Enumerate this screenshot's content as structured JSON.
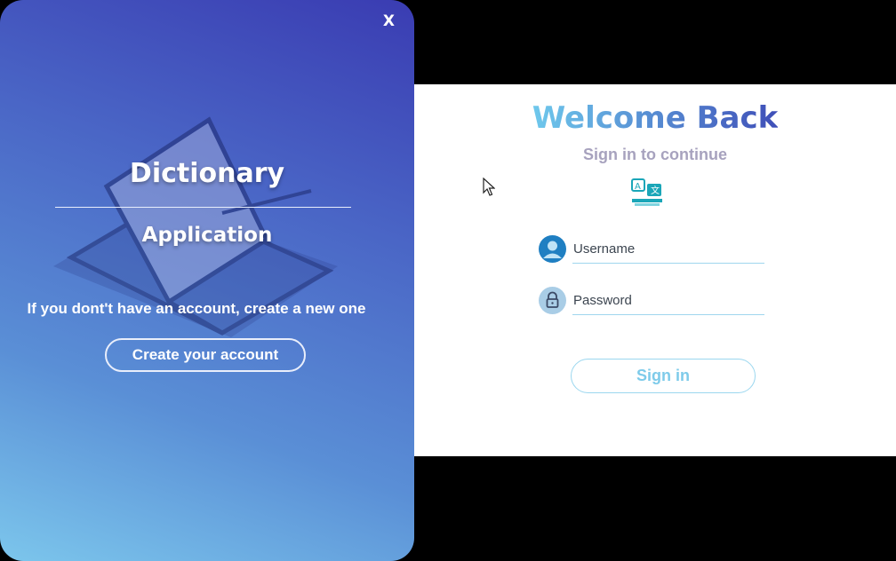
{
  "left_panel": {
    "close_label": "X",
    "title": "Dictionary",
    "subtitle": "Application",
    "prompt": "If you dont't have an account, create a new one",
    "create_button": "Create your account"
  },
  "right_panel": {
    "heading": "Welcome Back",
    "subheading": "Sign in to continue",
    "username_label": "Username",
    "password_label": "Password",
    "signin_button": "Sign in"
  },
  "icons": {
    "illustration": "open-book-icon",
    "logo": "translate-icon",
    "username": "user-icon",
    "password": "lock-icon",
    "cursor": "mouse-pointer-icon"
  },
  "colors": {
    "gradient_top": "#3a3cb2",
    "gradient_bottom": "#7cc6ec",
    "accent": "#7ecbea",
    "heading_start": "#6ec8ec",
    "heading_end": "#3f4fb8"
  }
}
